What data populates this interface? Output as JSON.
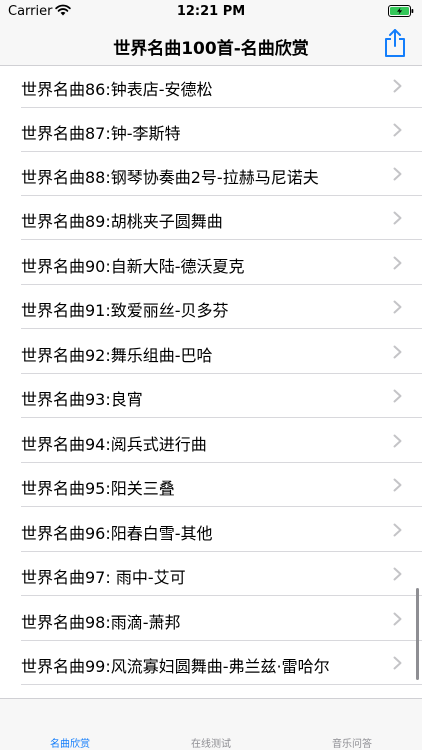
{
  "status": {
    "carrier": "Carrier",
    "time": "12:21 PM"
  },
  "nav": {
    "title": "世界名曲100首-名曲欣赏",
    "share_icon": "share-icon"
  },
  "list": {
    "items": [
      {
        "label": "世界名曲86:钟表店-安德松"
      },
      {
        "label": "世界名曲87:钟-李斯特"
      },
      {
        "label": "世界名曲88:钢琴协奏曲2号-拉赫马尼诺夫"
      },
      {
        "label": "世界名曲89:胡桃夹子圆舞曲"
      },
      {
        "label": "世界名曲90:自新大陆-德沃夏克"
      },
      {
        "label": "世界名曲91:致爱丽丝-贝多芬"
      },
      {
        "label": "世界名曲92:舞乐组曲-巴哈"
      },
      {
        "label": "世界名曲93:良宵"
      },
      {
        "label": "世界名曲94:阅兵式进行曲"
      },
      {
        "label": "世界名曲95:阳关三叠"
      },
      {
        "label": "世界名曲96:阳春白雪-其他"
      },
      {
        "label": "世界名曲97: 雨中-艾可"
      },
      {
        "label": "世界名曲98:雨滴-萧邦"
      },
      {
        "label": "世界名曲99:风流寡妇圆舞曲-弗兰兹·雷哈尔"
      }
    ]
  },
  "tabs": [
    {
      "label": "名曲欣赏",
      "selected": true
    },
    {
      "label": "在线测试",
      "selected": false
    },
    {
      "label": "音乐问答",
      "selected": false
    }
  ],
  "colors": {
    "accent": "#147efb",
    "inactive": "#8e8e93",
    "bar_bg": "#f7f7f7"
  }
}
